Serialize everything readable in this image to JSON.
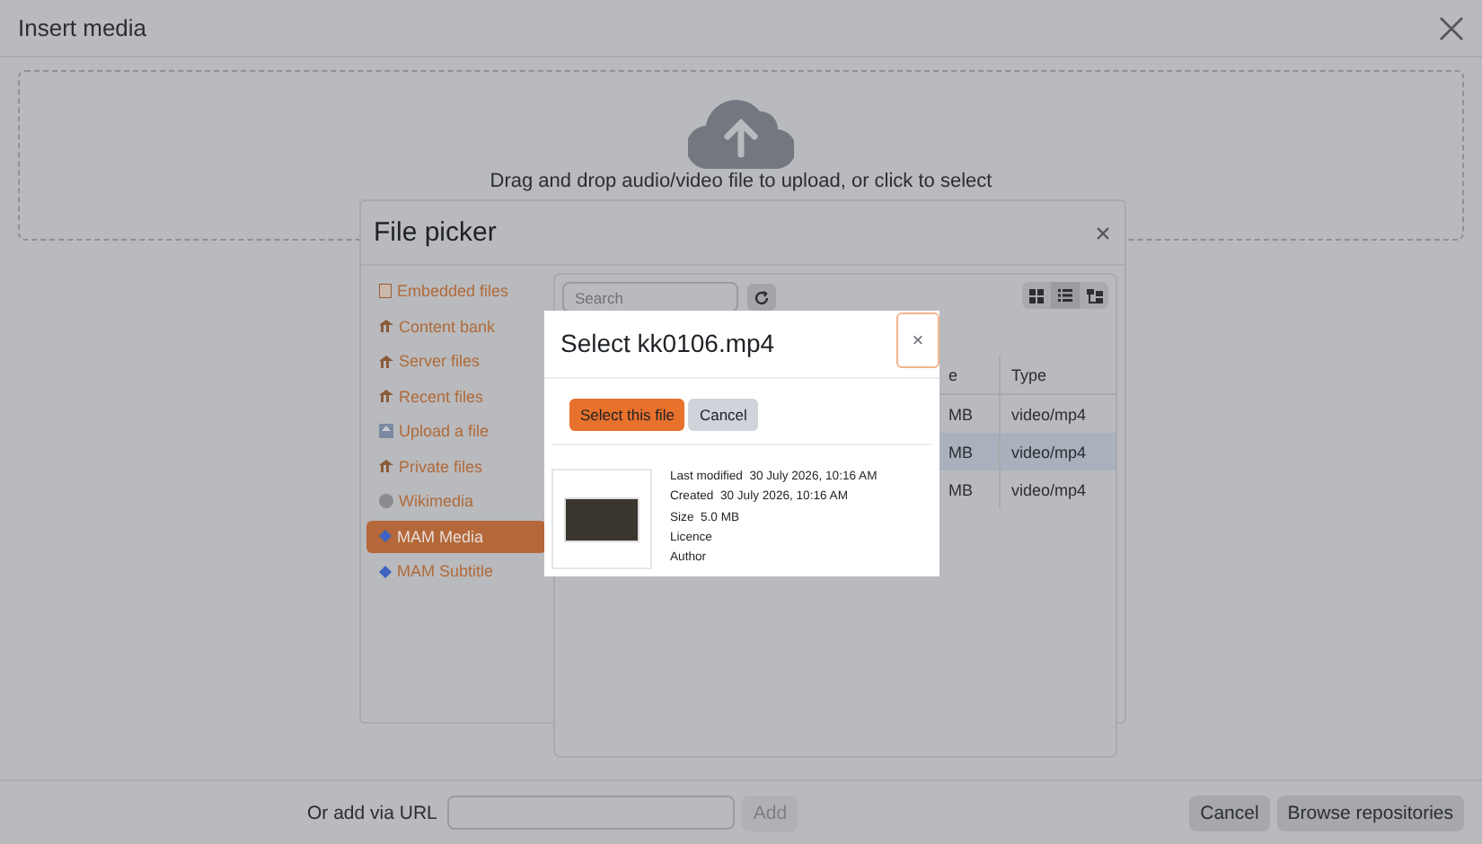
{
  "window": {
    "title": "Insert media"
  },
  "dropzone": {
    "text": "Drag and drop audio/video file to upload, or click to select"
  },
  "file_picker": {
    "title": "File picker",
    "repositories": [
      {
        "label": "Embedded files",
        "kind": "file",
        "selected": false
      },
      {
        "label": "Content bank",
        "kind": "repository",
        "selected": false
      },
      {
        "label": "Server files",
        "kind": "repository",
        "selected": false
      },
      {
        "label": "Recent files",
        "kind": "repository",
        "selected": false
      },
      {
        "label": "Upload a file",
        "kind": "upload",
        "selected": false
      },
      {
        "label": "Private files",
        "kind": "repository",
        "selected": false
      },
      {
        "label": "Wikimedia",
        "kind": "globe",
        "selected": false
      },
      {
        "label": "MAM Media",
        "kind": "mam",
        "selected": true
      },
      {
        "label": "MAM Subtitle",
        "kind": "mam",
        "selected": false
      }
    ],
    "search": {
      "placeholder": "Search"
    },
    "views": [
      {
        "kind": "icons",
        "selected": false
      },
      {
        "kind": "list",
        "selected": true
      },
      {
        "kind": "tree",
        "selected": false
      }
    ],
    "table": {
      "columns": [
        "e",
        "Type"
      ],
      "rows": [
        {
          "cells": [
            "MB",
            "video/mp4"
          ],
          "selected": false
        },
        {
          "cells": [
            "MB",
            "video/mp4"
          ],
          "selected": true
        },
        {
          "cells": [
            "MB",
            "video/mp4"
          ],
          "selected": false
        }
      ]
    }
  },
  "select_dialog": {
    "title": "Select kk0106.mp4",
    "close": "×",
    "buttons": [
      {
        "label": "Select this file",
        "kind": "primary"
      },
      {
        "label": "Cancel",
        "kind": "secondary"
      }
    ],
    "details": [
      {
        "label": "Last modified",
        "value": "30 July 2026, 10:16 AM"
      },
      {
        "label": "Created",
        "value": "30 July 2026, 10:16 AM"
      },
      {
        "label": "Size",
        "value": "5.0 MB"
      },
      {
        "label": "Licence"
      },
      {
        "label": "Author"
      }
    ]
  },
  "footer": {
    "url_label": "Or add via URL",
    "add_button": "Add",
    "buttons": [
      "Cancel",
      "Browse repositories"
    ]
  }
}
